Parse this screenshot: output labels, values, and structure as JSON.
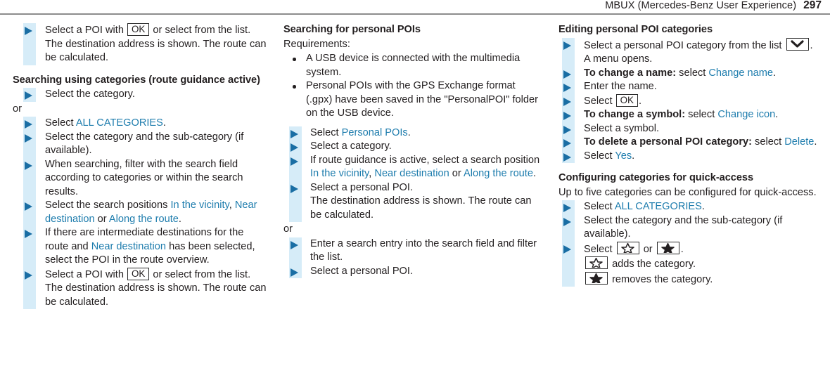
{
  "header": {
    "title": "MBUX (Mercedes-Benz User Experience)",
    "page_number": "297"
  },
  "icons": {
    "ok_key": "OK",
    "chevron_down_key": "chevron-down-icon",
    "star_outline_key": "star-outline-icon",
    "star_filled_key": "star-filled-icon"
  },
  "colors": {
    "link": "#1d7cad",
    "marker_triangle": "#1a6ea4",
    "marker_bar": "#d6ecf8",
    "text": "#231f20",
    "rule": "#8c8c8c"
  },
  "column1": {
    "step_poi_ok_1": {
      "lead": "Select a POI with",
      "tail": "or select from the",
      "line2": "list.",
      "line3": "The destination address is shown. The route",
      "line4": "can be calculated."
    },
    "heading_categories": "Searching using categories (route guidance active)",
    "step_select_category": "Select the category.",
    "or": "or",
    "step_all_categories": {
      "lead": "Select",
      "link": "ALL CATEGORIES",
      "tail": "."
    },
    "step_sub_category": "Select the category and the sub-category (if available).",
    "step_filter": "When searching, filter with the search field according to categories or within the search results.",
    "step_search_positions": {
      "lead": "Select the search positions",
      "link1": "In the vicinity",
      "sep1": ",",
      "link2": "Near destination",
      "sep2": "or",
      "link3": "Along the route",
      "tail": "."
    },
    "step_intermediate": {
      "lead": "If there are intermediate destinations for the route and",
      "link": "Near destination",
      "tail": "has been selected, select the POI in the route overview."
    },
    "step_poi_ok_2": {
      "lead": "Select a POI with",
      "tail": "or select from the",
      "line2": "list.",
      "line3": "The destination address is shown. The route",
      "line4": "can be calculated."
    }
  },
  "column2": {
    "heading": "Searching for personal POIs",
    "requirements_label": "Requirements:",
    "requirement_1": "A USB device is connected with the multimedia system.",
    "requirement_2": "Personal POIs with the GPS Exchange format (.gpx) have been saved in the \"PersonalPOI\" folder on the USB device.",
    "step_personal_pois": {
      "lead": "Select",
      "link": "Personal POIs",
      "tail": "."
    },
    "step_select_category": "Select a category.",
    "step_route_guidance": {
      "lead": "If route guidance is active, select a search position",
      "link1": "In the vicinity",
      "sep1": ",",
      "link2": "Near destination",
      "sep2": "or",
      "link3": "Along the route",
      "tail": "."
    },
    "step_select_poi": {
      "line1": "Select a personal POI.",
      "line2": "The destination address is shown. The route",
      "line3": "can be calculated."
    },
    "or": "or",
    "step_enter_search": "Enter a search entry into the search field and filter the list.",
    "step_select_poi_2": "Select a personal POI."
  },
  "column3": {
    "heading_editing": "Editing personal POI categories",
    "step_select_from_list": {
      "lead": "Select a personal POI category from the list",
      "tail": ".",
      "line2": "A menu opens."
    },
    "step_change_name": {
      "bold": "To change a name:",
      "lead": "select",
      "link": "Change name",
      "tail": "."
    },
    "step_enter_name": "Enter the name.",
    "step_select_ok": {
      "lead": "Select",
      "tail": "."
    },
    "step_change_symbol": {
      "bold": "To change a symbol:",
      "lead": "select",
      "link": "Change icon",
      "tail": "."
    },
    "step_select_symbol": "Select a symbol.",
    "step_delete_category": {
      "bold": "To delete a personal POI category:",
      "lead": "select",
      "link": "Delete",
      "tail": "."
    },
    "step_select_yes": {
      "lead": "Select",
      "link": "Yes",
      "tail": "."
    },
    "heading_quick_access": "Configuring categories for quick-access",
    "quick_access_para": "Up to five categories can be configured for quick-access.",
    "step_all_categories": {
      "lead": "Select",
      "link": "ALL CATEGORIES",
      "tail": "."
    },
    "step_sub_category": "Select the category and the sub-category (if available).",
    "step_select_star": {
      "lead": "Select",
      "mid": "or",
      "tail": ".",
      "line2": "adds the category.",
      "line3": "removes the category."
    }
  }
}
